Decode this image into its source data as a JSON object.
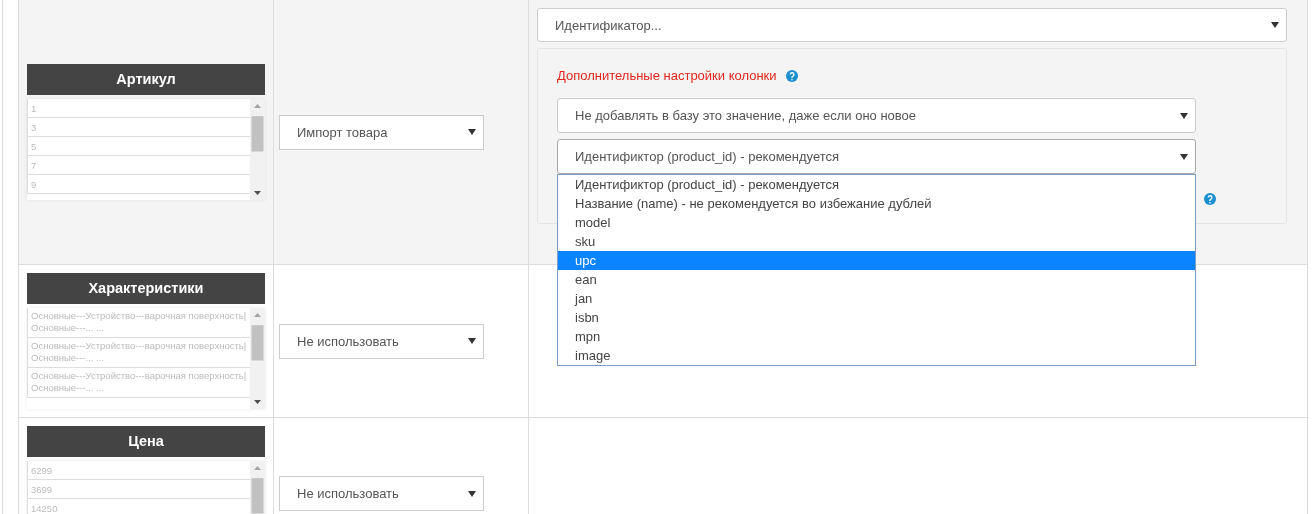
{
  "rows": [
    {
      "name": "Артикул",
      "samples": [
        "1",
        "3",
        "5",
        "7",
        "9"
      ],
      "action": "Импорт товара",
      "settings": {
        "identifier_select": "Идентификатор...",
        "panel": {
          "title": "Дополнительные настройки колонки",
          "add_select": "Не добавлять в базу это значение, даже если оно новое",
          "key_select": "Идентификтор (product_id) - рекомендуется",
          "options": [
            {
              "label": "Идентификтор (product_id) - рекомендуется",
              "selected": false
            },
            {
              "label": "Название (name) - не рекомендуется во избежание дублей",
              "selected": false
            },
            {
              "label": "model",
              "selected": false
            },
            {
              "label": "sku",
              "selected": false
            },
            {
              "label": "upc",
              "selected": true
            },
            {
              "label": "ean",
              "selected": false
            },
            {
              "label": "jan",
              "selected": false
            },
            {
              "label": "isbn",
              "selected": false
            },
            {
              "label": "mpn",
              "selected": false
            },
            {
              "label": "image",
              "selected": false
            }
          ]
        }
      }
    },
    {
      "name": "Характеристики",
      "samples": [
        "Основные---Устройство---варочная поверхность|Основные---... ...",
        "Основные---Устройство---варочная поверхность|Основные---... ...",
        "Основные---Устройство---варочная поверхность|Основные---... ..."
      ],
      "action": "Не использовать"
    },
    {
      "name": "Цена",
      "samples": [
        "6299",
        "3699",
        "14250"
      ],
      "action": "Не использовать"
    }
  ]
}
